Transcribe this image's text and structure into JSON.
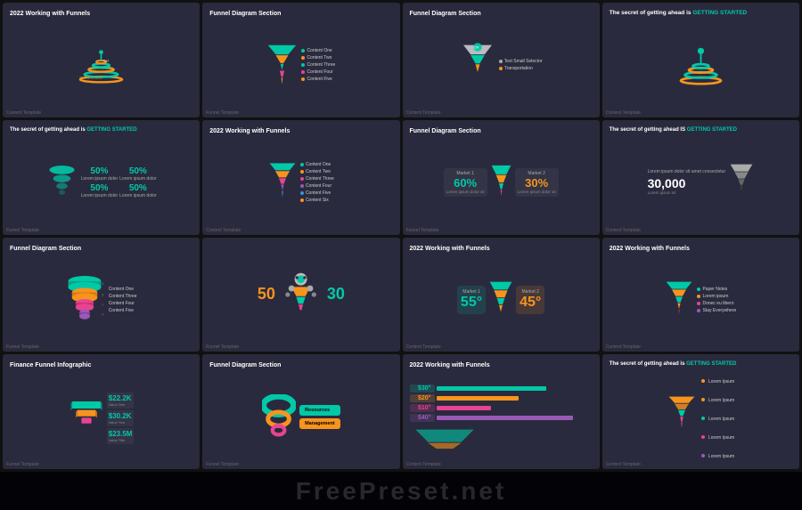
{
  "watermark": "FreePreset.net",
  "slides": [
    {
      "id": 1,
      "title": "2022 Working with Funnels",
      "type": "spiral-title",
      "label": "Content Template"
    },
    {
      "id": 2,
      "title": "Funnel Diagram Section",
      "type": "funnel-list",
      "items": [
        "Content One",
        "Content Two",
        "Content Three",
        "Content Four",
        "Content Five"
      ],
      "label": "Funnel Template"
    },
    {
      "id": 3,
      "title": "Funnel Diagram Section",
      "type": "funnel-market",
      "markets": [
        "Text Small Selector",
        "Transportation"
      ],
      "label": "Content Template"
    },
    {
      "id": 4,
      "title": "The secret of getting ahead is GETTING STARTED",
      "type": "secret-spiral",
      "highlight": "GETTING STARTED",
      "label": "Content Template"
    },
    {
      "id": 5,
      "title": "The secret of getting ahead is GETTING STARTED",
      "type": "stats-4",
      "stats": [
        "50%",
        "50%",
        "50%",
        "50%"
      ],
      "statLabels": [
        "Lorem ipsum dolor",
        "Lorem ipsum dolor",
        "Lorem ipsum dolor",
        "Lorem ipsum dolor"
      ],
      "label": "Funnel Template"
    },
    {
      "id": 6,
      "title": "2022 Working with Funnels",
      "type": "funnel-content-list",
      "items": [
        "Content One",
        "Content Two",
        "Content Three",
        "Content Four",
        "Content Five",
        "Content Six"
      ],
      "label": "Content Template"
    },
    {
      "id": 7,
      "title": "Funnel Diagram Section",
      "type": "funnel-double-market",
      "market1": "Market 1",
      "market2": "Market 2",
      "pct1": "60%",
      "pct2": "30%",
      "label": "Funnel Template"
    },
    {
      "id": 8,
      "title": "The secret of getting ahead IS GETTING STARTED",
      "type": "secret-number",
      "number": "30,000",
      "label": "Content Template"
    },
    {
      "id": 9,
      "title": "Funnel Diagram Section",
      "type": "funnel-3d",
      "items": [
        "Content One",
        "Content Three",
        "Content Four",
        "Content Five"
      ],
      "label": "Funnel Template"
    },
    {
      "id": 10,
      "title": "",
      "type": "funnel-50-30",
      "numbers": [
        "50",
        "30"
      ],
      "label": "Funnel Template"
    },
    {
      "id": 11,
      "title": "2022 Working with Funnels",
      "type": "funnel-55-45",
      "pct1": "55°",
      "pct2": "45°",
      "market1": "Market 1",
      "market2": "Market 2",
      "label": "Content Template"
    },
    {
      "id": 12,
      "title": "2022 Working with Funnels",
      "type": "funnel-paper",
      "items": [
        "Paper Notes",
        "Lorem ipsum",
        "Donec eu libero",
        "Stay Everywhere"
      ],
      "label": "Content Template"
    },
    {
      "id": 13,
      "title": "Finance Funnel Infographic",
      "type": "finance",
      "stats": [
        "$22.2K",
        "$30.2K",
        "$23.5M"
      ],
      "statLabels": [
        "Value One",
        "Value Two",
        "Value Title"
      ],
      "label": "Funnel Template"
    },
    {
      "id": 14,
      "title": "Funnel Diagram Section",
      "type": "funnel-rings",
      "items": [
        "Resources",
        "Management"
      ],
      "label": "Funnel Template"
    },
    {
      "id": 15,
      "title": "2022 Working with Funnels",
      "type": "funnel-stats-2",
      "stats": [
        "$30°",
        "$20°",
        "$10°",
        "$40°"
      ],
      "label": "Content Template"
    },
    {
      "id": 16,
      "title": "The secret of getting ahead is GETTING STARTED",
      "type": "secret-funnel-colored",
      "items": [
        "Lorem Ipsum",
        "Lorem Ipsum",
        "Lorem Ipsum",
        "Lorem Ipsum",
        "Lorem Ipsum"
      ],
      "label": "Content Template"
    }
  ]
}
